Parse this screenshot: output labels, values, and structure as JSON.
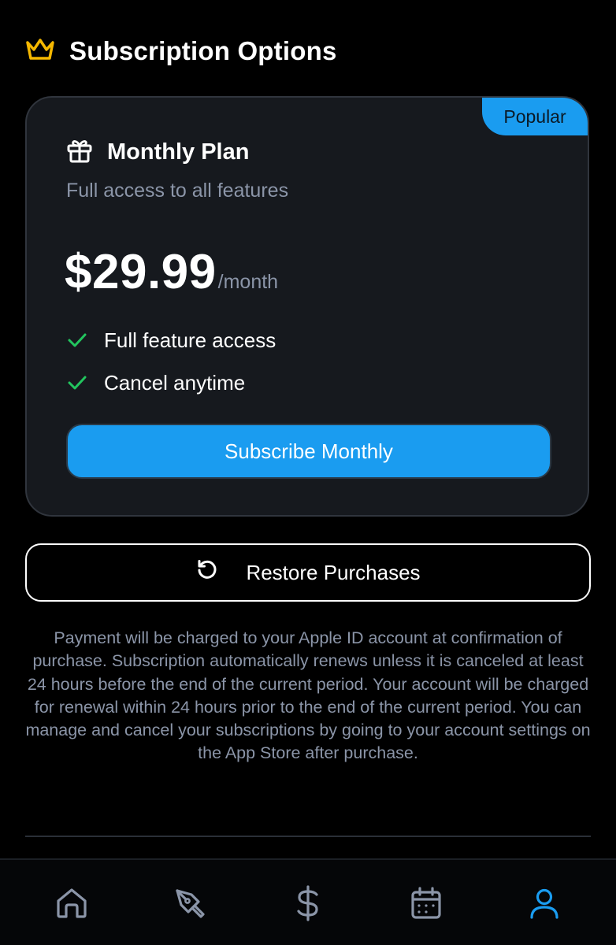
{
  "header": {
    "title": "Subscription Options",
    "icon": "crown-icon",
    "icon_color": "#f5b800"
  },
  "plan": {
    "badge": "Popular",
    "icon": "gift-icon",
    "title": "Monthly Plan",
    "subtitle": "Full access to all features",
    "price": "$29.99",
    "period": "/month",
    "features": [
      {
        "label": "Full feature access",
        "icon": "check-icon"
      },
      {
        "label": "Cancel anytime",
        "icon": "check-icon"
      }
    ],
    "subscribe_label": "Subscribe Monthly"
  },
  "restore": {
    "label": "Restore Purchases",
    "icon": "restore-icon"
  },
  "legal": {
    "text": "Payment will be charged to your Apple ID account at confirmation of purchase. Subscription automatically renews unless it is canceled at least 24 hours before the end of the current period. Your account will be charged for renewal within 24 hours prior to the end of the current period. You can manage and cancel your subscriptions by going to your account settings on the App Store after purchase."
  },
  "tabbar": {
    "items": [
      {
        "icon": "home-icon",
        "active": false
      },
      {
        "icon": "pen-icon",
        "active": false
      },
      {
        "icon": "dollar-icon",
        "active": false
      },
      {
        "icon": "calendar-icon",
        "active": false
      },
      {
        "icon": "user-icon",
        "active": true
      }
    ]
  },
  "colors": {
    "accent": "#1a9cf0",
    "check": "#22c55e",
    "muted": "#8b95a8",
    "inactive_tab": "#8b95a8"
  }
}
